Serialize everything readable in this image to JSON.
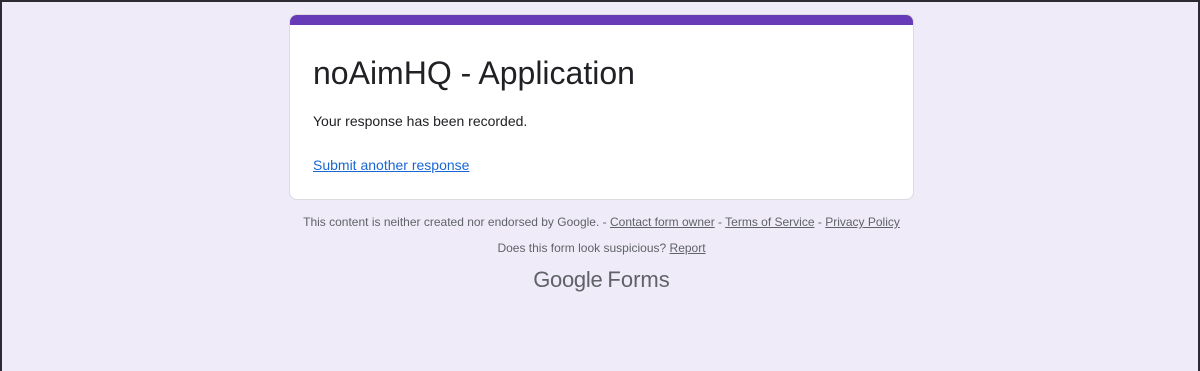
{
  "form": {
    "title": "noAimHQ - Application",
    "confirmation_message": "Your response has been recorded.",
    "submit_another_label": "Submit another response",
    "accent_color": "#673ab7",
    "background_color": "#f0ebf8"
  },
  "footer": {
    "disclaimer": "This content is neither created nor endorsed by Google.",
    "separator": " - ",
    "contact_owner_label": "Contact form owner",
    "terms_label": "Terms of Service",
    "privacy_label": "Privacy Policy",
    "suspicious_question": "Does this form look suspicious?",
    "report_label": "Report"
  },
  "brand": {
    "google": "Google",
    "forms": "Forms"
  }
}
